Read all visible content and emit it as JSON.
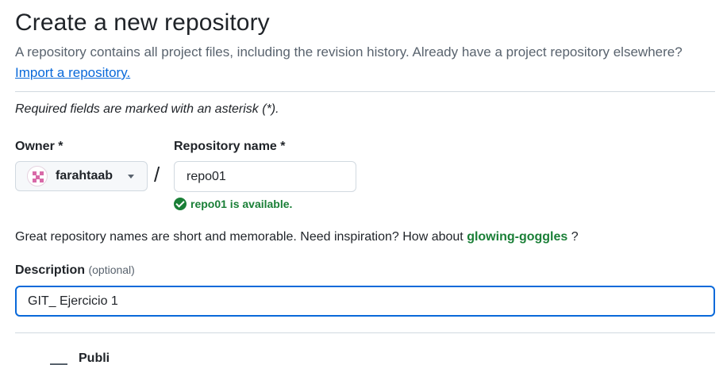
{
  "header": {
    "title": "Create a new repository",
    "subtitle": "A repository contains all project files, including the revision history. Already have a project repository elsewhere?",
    "import_link": "Import a repository."
  },
  "form": {
    "required_note": "Required fields are marked with an asterisk (*).",
    "owner_label": "Owner *",
    "owner_value": "farahtaab",
    "separator": "/",
    "repo_name_label": "Repository name *",
    "repo_name_value": "repo01",
    "availability": "repo01 is available.",
    "inspiration_text": "Great repository names are short and memorable. Need inspiration? How about",
    "inspiration_suggestion": "glowing-goggles",
    "inspiration_end": " ?",
    "description_label": "Description",
    "description_optional": "(optional)",
    "description_value": "GIT_ Ejercicio 1",
    "visibility_partial": "Publi"
  },
  "colors": {
    "link": "#0969da",
    "success": "#1a7f37",
    "focus_border": "#0969da",
    "muted_text": "#59636e"
  }
}
